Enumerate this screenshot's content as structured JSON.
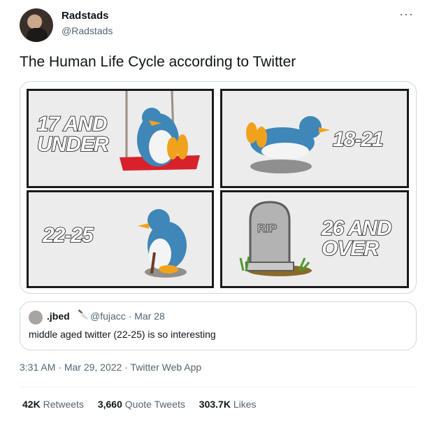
{
  "author": {
    "name": "Radstads",
    "handle": "@Radstads"
  },
  "tweet": {
    "text": "The Human Life Cycle according to Twitter"
  },
  "media": {
    "panels": [
      {
        "label_lines": [
          "17 AND",
          "UNDER"
        ],
        "icon": "penguin-on-swing"
      },
      {
        "label_lines": [
          "18-21"
        ],
        "icon": "penguin-sliding"
      },
      {
        "label_lines": [
          "22-25"
        ],
        "icon": "old-penguin-with-cane"
      },
      {
        "label_lines": [
          "26 AND",
          "OVER"
        ],
        "icon": "rip-gravestone"
      }
    ],
    "gravestone_text": "RIP"
  },
  "quote": {
    "name": ".jbed",
    "handle": "@fujacc",
    "sep": "·",
    "date": "Mar 28",
    "text": "middle aged twitter (22-25) is so interesting"
  },
  "meta": {
    "time": "3:31 AM",
    "sep": "·",
    "date": "Mar 29, 2022",
    "source": "Twitter Web App"
  },
  "stats": {
    "retweets_count": "42K",
    "retweets_label": "Retweets",
    "quotes_count": "3,660",
    "quotes_label": "Quote Tweets",
    "likes_count": "303.7K",
    "likes_label": "Likes"
  }
}
